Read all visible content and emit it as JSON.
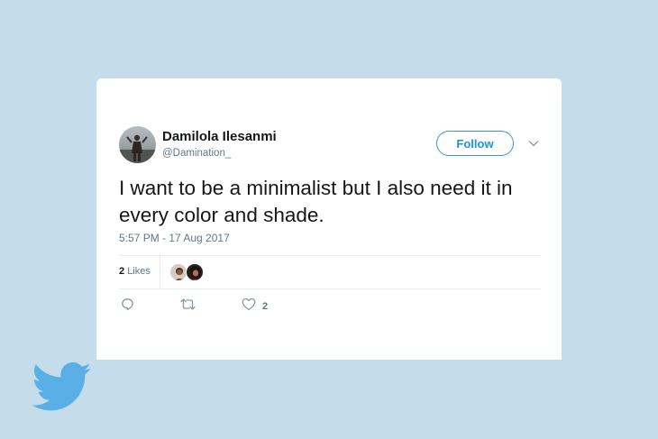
{
  "tweet": {
    "author_name": "Damilola Ilesanmi",
    "author_handle": "@Damination_",
    "follow_label": "Follow",
    "text": "I want to be a minimalist but I also need it in every color and shade.",
    "timestamp": "5:57 PM - 17 Aug 2017",
    "likes_count": "2",
    "likes_label": "Likes",
    "like_action_count": "2"
  },
  "colors": {
    "background": "#c5dceb",
    "card": "#ffffff",
    "accent": "#1b95e0",
    "bird": "#5ab0e6",
    "secondary_text": "#657786"
  },
  "icons": {
    "reply": "reply-icon",
    "retweet": "retweet-icon",
    "like": "heart-icon",
    "more": "chevron-down-icon",
    "brand": "twitter-bird-icon"
  }
}
